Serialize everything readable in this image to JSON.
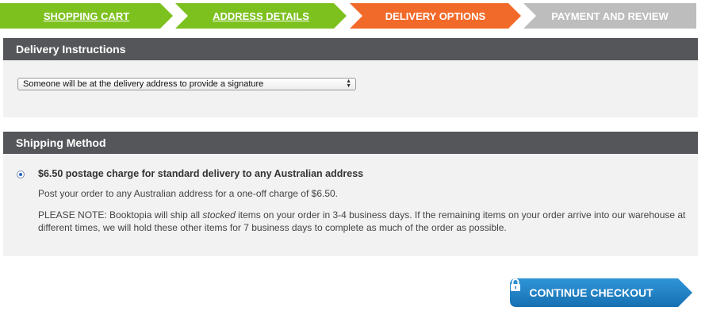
{
  "steps": [
    {
      "label": "SHOPPING CART",
      "state": "done",
      "color": "#7dc11f"
    },
    {
      "label": "ADDRESS DETAILS",
      "state": "done",
      "color": "#7dc11f"
    },
    {
      "label": "DELIVERY OPTIONS",
      "state": "current",
      "color": "#f26a2a"
    },
    {
      "label": "PAYMENT AND REVIEW",
      "state": "upcoming",
      "color": "#bdbdbd"
    }
  ],
  "delivery": {
    "title": "Delivery Instructions",
    "select_value": "Someone will be at the delivery address to provide a signature"
  },
  "shipping": {
    "title": "Shipping Method",
    "option_title": "$6.50 postage charge for standard delivery to any Australian address",
    "option_desc": "Post your order to any Australian address for a one-off charge of $6.50.",
    "note_prefix": "PLEASE NOTE: Booktopia will ship all ",
    "note_emph": "stocked",
    "note_suffix": " items on your order in 3-4 business days. If the remaining items on your order arrive into our warehouse at different times, we will hold these other items for 7 business days to complete as much of the order as possible.",
    "selected": true
  },
  "checkout": {
    "label": "CONTINUE CHECKOUT",
    "icon": "lock-icon",
    "color": "#1a7fc4"
  }
}
